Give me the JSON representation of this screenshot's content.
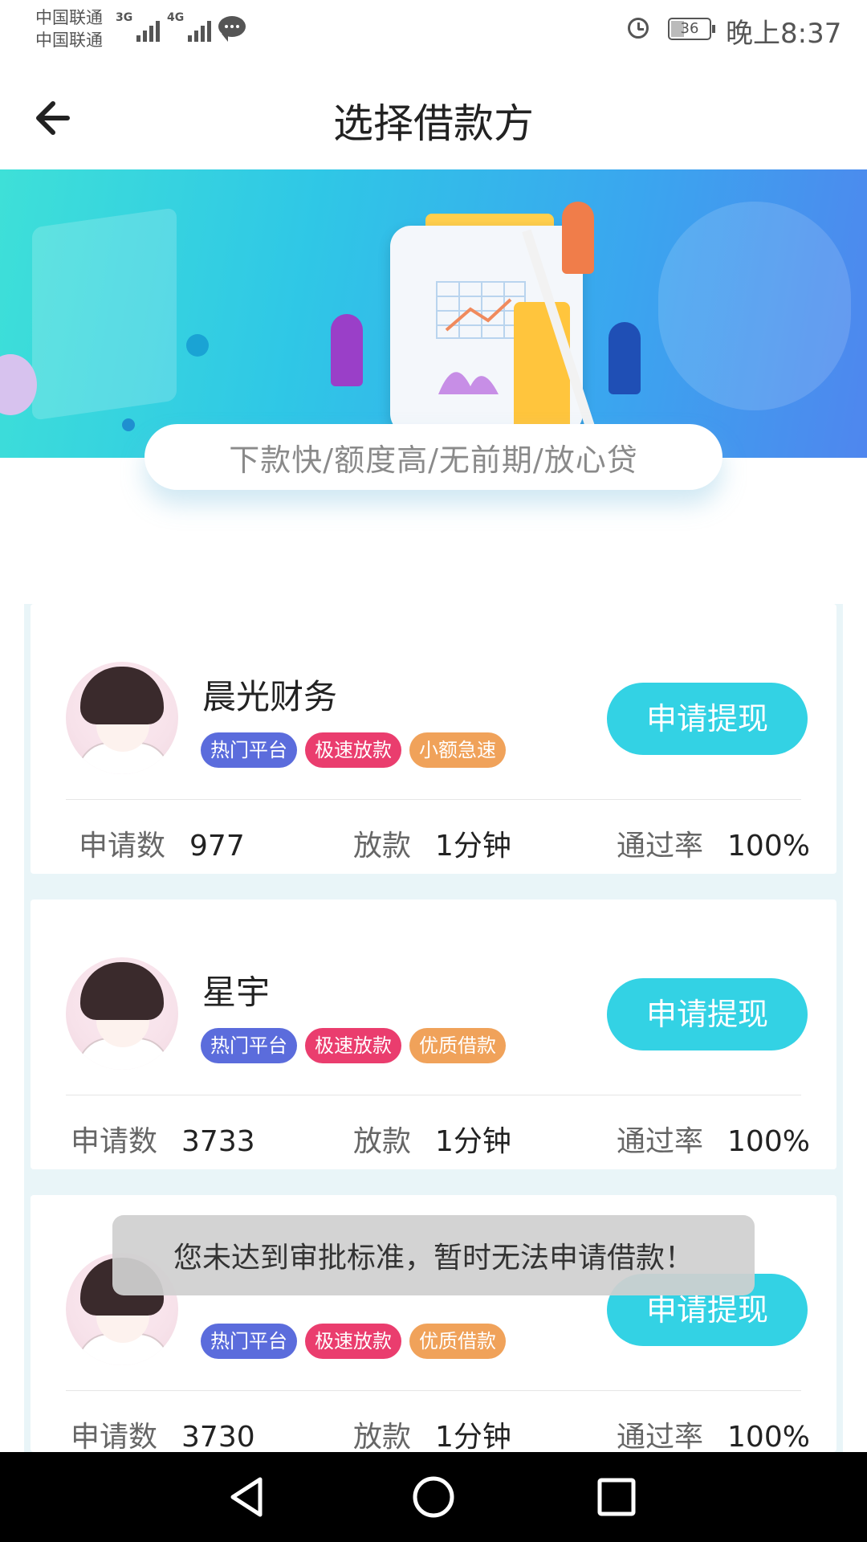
{
  "status_bar": {
    "carrier_1": "中国联通",
    "carrier_2": "中国联通",
    "net_1": "3G",
    "net_2": "4G",
    "battery": "36",
    "time": "晚上8:37"
  },
  "header": {
    "back_icon": "arrow-left-icon",
    "title": "选择借款方"
  },
  "banner": {
    "slogan": "下款快/额度高/无前期/放心贷"
  },
  "lenders": [
    {
      "name": "晨光财务",
      "tags": [
        {
          "label": "热门平台",
          "color": "#5b6cdc"
        },
        {
          "label": "极速放款",
          "color": "#ea3d6e"
        },
        {
          "label": "小额急速",
          "color": "#f0a25a"
        }
      ],
      "apply_label": "申请提现",
      "applications_label": "申请数",
      "applications": "977",
      "loan_label": "放款",
      "loan_time": "1分钟",
      "pass_rate_label": "通过率",
      "pass_rate": "100%"
    },
    {
      "name": "星宇",
      "tags": [
        {
          "label": "热门平台",
          "color": "#5b6cdc"
        },
        {
          "label": "极速放款",
          "color": "#ea3d6e"
        },
        {
          "label": "优质借款",
          "color": "#f0a25a"
        }
      ],
      "apply_label": "申请提现",
      "applications_label": "申请数",
      "applications": "3733",
      "loan_label": "放款",
      "loan_time": "1分钟",
      "pass_rate_label": "通过率",
      "pass_rate": "100%"
    },
    {
      "name": "",
      "tags": [
        {
          "label": "热门平台",
          "color": "#5b6cdc"
        },
        {
          "label": "极速放款",
          "color": "#ea3d6e"
        },
        {
          "label": "优质借款",
          "color": "#f0a25a"
        }
      ],
      "apply_label": "申请提现",
      "applications_label": "申请数",
      "applications": "3730",
      "loan_label": "放款",
      "loan_time": "1分钟",
      "pass_rate_label": "通过率",
      "pass_rate": "100%"
    }
  ],
  "toast": {
    "message": "您未达到审批标准，暂时无法申请借款！"
  },
  "nav_bar": {
    "back_icon": "triangle-back-icon",
    "home_icon": "circle-home-icon",
    "recents_icon": "square-recents-icon"
  },
  "colors": {
    "accent": "#33d2e4",
    "tag_hot": "#5b6cdc",
    "tag_fast": "#ea3d6e",
    "tag_quality": "#f0a25a"
  }
}
